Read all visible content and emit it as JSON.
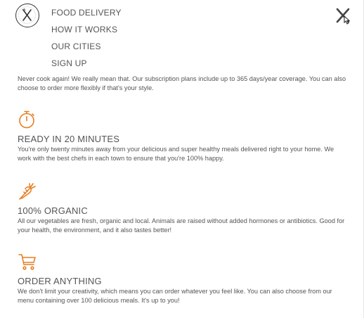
{
  "nav": {
    "items": [
      {
        "label": "FOOD DELIVERY"
      },
      {
        "label": "HOW IT WORKS"
      },
      {
        "label": "OUR CITIES"
      },
      {
        "label": "SIGN UP"
      }
    ]
  },
  "features": [
    {
      "description": "Never cook again! We really mean that. Our subscription plans include up to 365 days/year coverage. You can also choose to order more flexibly if that's your style."
    },
    {
      "icon": "stopwatch-icon",
      "title": "READY IN 20 MINUTES",
      "description": "You're only twenty minutes away from your delicious and super healthy meals delivered right to your home. We work with the best chefs in each town to ensure that you're 100% happy."
    },
    {
      "icon": "carrot-icon",
      "title": "100% ORGANIC",
      "description": "All our vegetables are fresh, organic and local. Animals are raised without added hormones or antibiotics. Good for your health, the environment, and it also tastes better!"
    },
    {
      "icon": "cart-icon",
      "title": "ORDER ANYTHING",
      "description": "We don't limit your creativity, which means you can order whatever you feel like. You can also choose from our menu containing over 100 delicious meals. It's up to you!"
    }
  ],
  "colors": {
    "accent": "#e67e22",
    "text": "#555555",
    "background": "#ffffff"
  }
}
